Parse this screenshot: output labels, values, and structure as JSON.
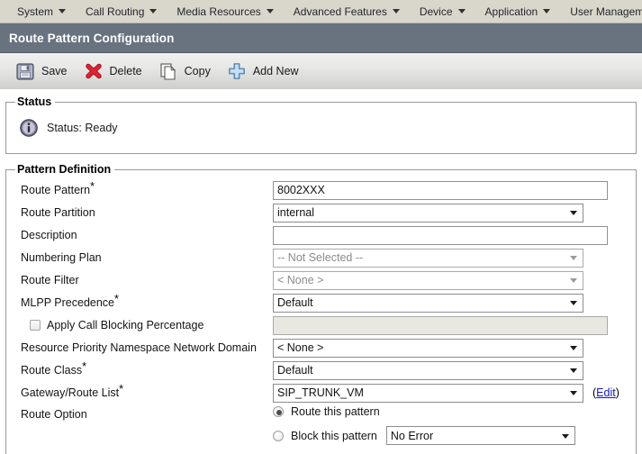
{
  "menubar": {
    "items": [
      {
        "label": "System",
        "has_caret": true
      },
      {
        "label": "Call Routing",
        "has_caret": true
      },
      {
        "label": "Media Resources",
        "has_caret": true
      },
      {
        "label": "Advanced Features",
        "has_caret": true
      },
      {
        "label": "Device",
        "has_caret": true
      },
      {
        "label": "Application",
        "has_caret": true
      },
      {
        "label": "User Management",
        "has_caret": true
      }
    ]
  },
  "header": {
    "title": "Route Pattern Configuration"
  },
  "toolbar": {
    "buttons": [
      {
        "label": "Save",
        "icon": "save-floppy-icon"
      },
      {
        "label": "Delete",
        "icon": "delete-x-icon"
      },
      {
        "label": "Copy",
        "icon": "copy-pages-icon"
      },
      {
        "label": "Add New",
        "icon": "add-plus-icon"
      }
    ]
  },
  "status": {
    "legend": "Status",
    "icon": "info-icon",
    "text": "Status: Ready"
  },
  "pattern_definition": {
    "legend": "Pattern Definition",
    "fields": {
      "route_pattern": {
        "label": "Route Pattern",
        "required": true,
        "value": "8002XXX",
        "placeholder": ""
      },
      "route_partition": {
        "label": "Route Partition",
        "required": false,
        "value": "internal"
      },
      "description": {
        "label": "Description",
        "required": false,
        "value": "",
        "placeholder": ""
      },
      "numbering_plan": {
        "label": "Numbering Plan",
        "required": false,
        "value": "-- Not Selected --",
        "disabled": true
      },
      "route_filter": {
        "label": "Route Filter",
        "required": false,
        "value": "< None >",
        "disabled": true
      },
      "mlpp_precedence": {
        "label": "MLPP Precedence",
        "required": true,
        "value": "Default"
      },
      "apply_call_blocking": {
        "label": "Apply Call Blocking Percentage",
        "checked": false,
        "value": "",
        "disabled": true
      },
      "resource_priority_domain": {
        "label": "Resource Priority Namespace Network Domain",
        "required": false,
        "value": "< None >"
      },
      "route_class": {
        "label": "Route Class",
        "required": true,
        "value": "Default"
      },
      "gateway_route_list": {
        "label": "Gateway/Route List",
        "required": true,
        "value": "SIP_TRUNK_VM",
        "edit_prefix": "(",
        "edit_label": "Edit",
        "edit_suffix": ")"
      },
      "route_option": {
        "label": "Route Option",
        "route_this_pattern": {
          "label": "Route this pattern",
          "selected": true
        },
        "block_this_pattern": {
          "label": "Block this pattern",
          "selected": false,
          "reason": "No Error"
        }
      }
    }
  },
  "colors": {
    "menubar_bg": "#d9d7cc",
    "titlebar_bg": "#69727f",
    "title_text": "#ffffff",
    "link": "#1414d0",
    "disabled_field_bg": "#e8e8e0"
  }
}
